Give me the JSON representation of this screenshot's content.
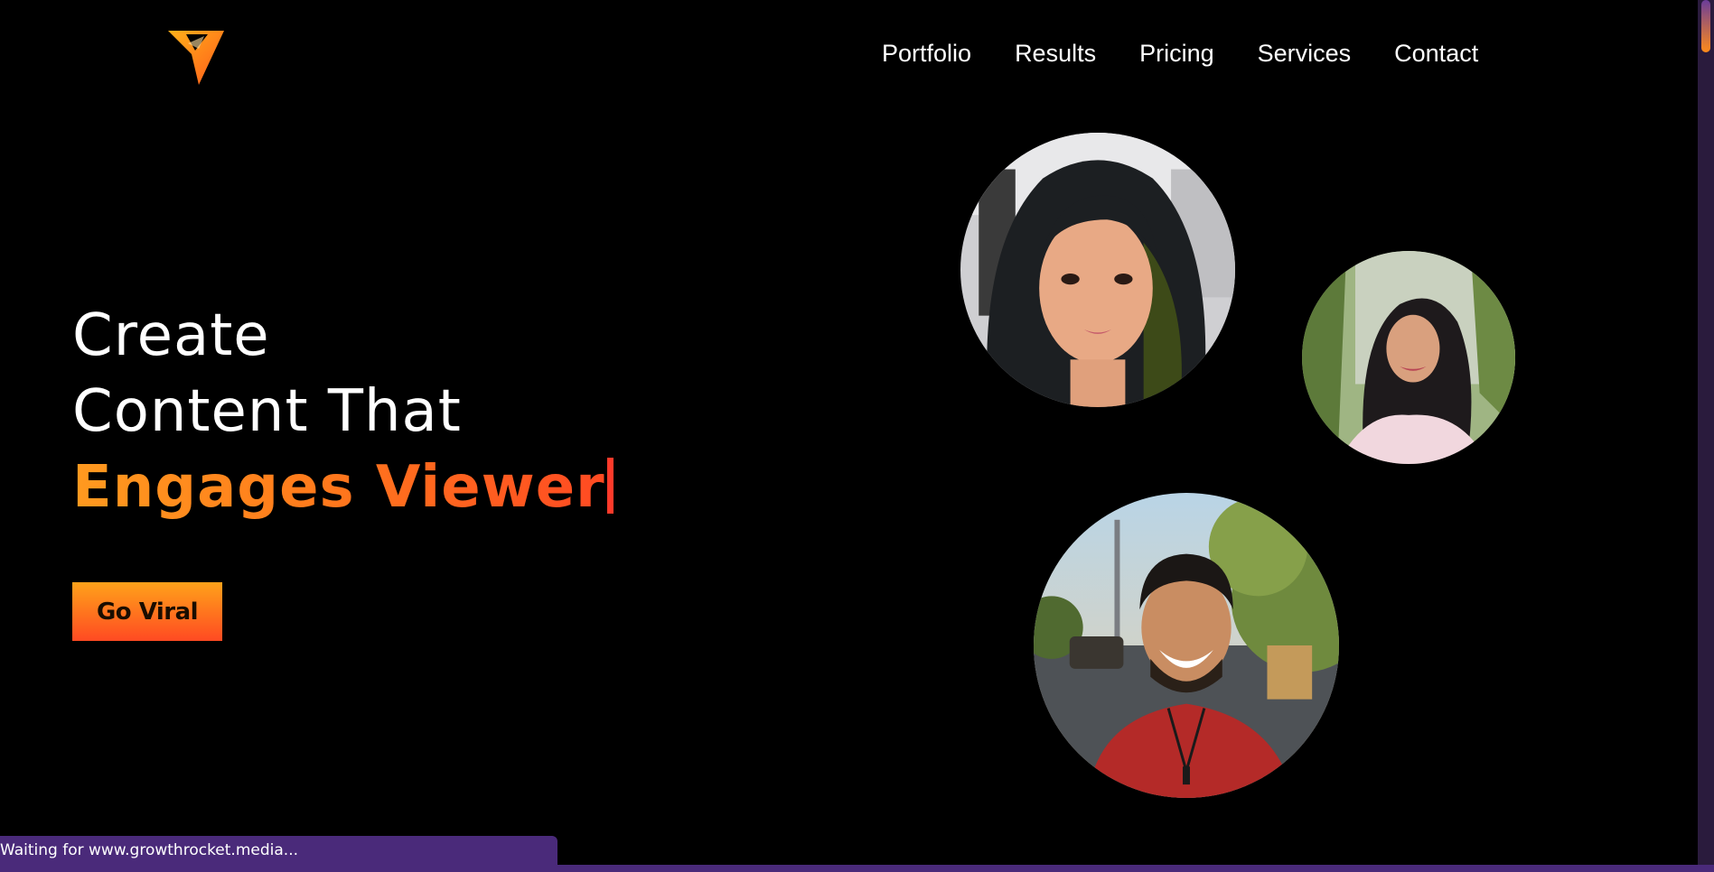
{
  "nav": {
    "items": [
      "Portfolio",
      "Results",
      "Pricing",
      "Services",
      "Contact"
    ]
  },
  "hero": {
    "line1": "Create",
    "line2": "Content That",
    "line3": "Engages Viewer",
    "cta_label": "Go Viral"
  },
  "status_bar": {
    "text": "Waiting for www.growthrocket.media..."
  },
  "colors": {
    "background": "#000000",
    "accent_orange": "#ff9a1f",
    "accent_red": "#ff4a22",
    "status_bar": "#4a2a7a"
  },
  "icons": {
    "logo": "rocket-triangle-logo-icon"
  }
}
